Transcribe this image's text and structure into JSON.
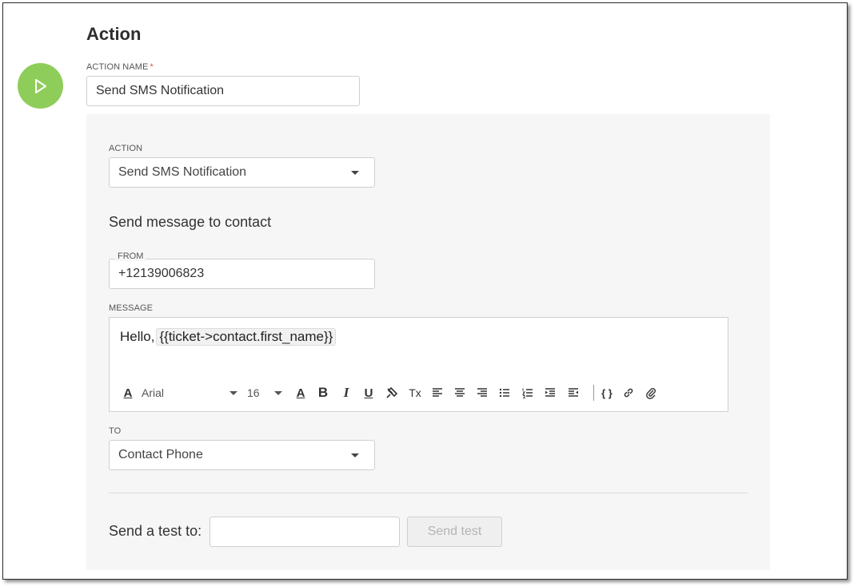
{
  "header": {
    "title": "Action"
  },
  "colors": {
    "play_button": "#8fcd5a",
    "required_asterisk": "#d9534f",
    "panel_background": "#f6f6f6"
  },
  "action_name": {
    "label": "ACTION NAME",
    "required_marker": "*",
    "value": "Send SMS Notification"
  },
  "action_select": {
    "label": "ACTION",
    "selected": "Send SMS Notification"
  },
  "section": {
    "title": "Send message to contact"
  },
  "from_field": {
    "label": "FROM",
    "value": "+12139006823"
  },
  "message": {
    "label": "MESSAGE",
    "greeting": "Hello,",
    "variable": "{{ticket->contact.first_name}}",
    "toolbar": {
      "font_family": "Arial",
      "font_size": "16",
      "icons": [
        "font-color-icon",
        "font-family-dropdown",
        "font-size-dropdown",
        "text-color-icon",
        "bold-icon",
        "italic-icon",
        "underline-icon",
        "format-painter-icon",
        "clear-formatting-icon",
        "align-left-icon",
        "align-center-icon",
        "align-right-icon",
        "bullet-list-icon",
        "numbered-list-icon",
        "indent-icon",
        "outdent-icon",
        "insert-variable-icon",
        "link-icon",
        "attachment-icon"
      ],
      "bold_glyph": "B",
      "italic_glyph": "I",
      "underline_glyph": "U",
      "text_color_glyph": "A",
      "font_color_glyph": "A",
      "clear_glyph": "Tx",
      "variable_glyph": "{ }"
    }
  },
  "to_select": {
    "label": "TO",
    "selected": "Contact Phone"
  },
  "test": {
    "label": "Send a test to:",
    "input_value": "",
    "button_label": "Send test"
  }
}
